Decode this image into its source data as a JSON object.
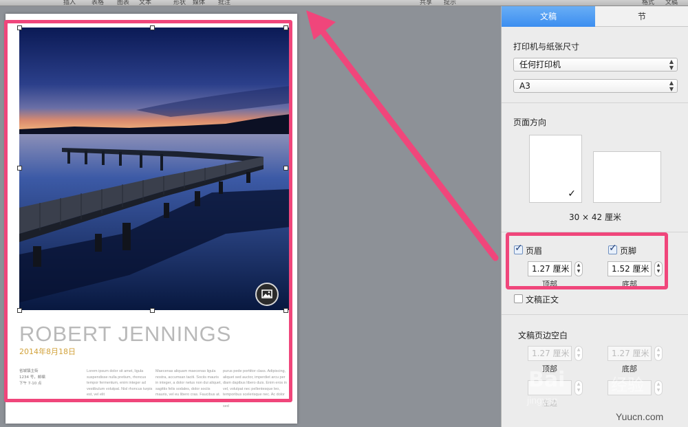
{
  "toolbar": {
    "items": [
      "插入",
      "表格",
      "图表",
      "文本",
      "形状",
      "媒体",
      "批注",
      "共享",
      "提示",
      "格式",
      "文稿"
    ]
  },
  "document": {
    "title": "ROBERT JENNINGS",
    "date": "2014年8月18日",
    "address": [
      "省城镇主街",
      "1234 号，邮编",
      "下午 7-10 点"
    ],
    "columns": [
      "Lorem ipsum dolor sit amet, ligula suspendisse nulla pretium, rhoncus tempor fermentum, enim integer ad vestibulum volutpat. Nisl rhoncus turpis est, vel elit",
      "Maecenas aliquam maecenas ligula nostra, accumsan taciti. Sociis mauris in integer, a dolor netus non dui aliquet, sagittis felis sodales, dolor sociis mauris, vel eu libero cras. Faucibus at. Arcu habitasse elementum est, ipsum",
      "purus pede porttitor class. Adipiscing, aliquet sed auctor, imperdiet arcu per diam dapibus libero duis. Enim eros in vel, volutpat nec pellentesque leo, temporibus scelerisque nec. Ac dolor ac adipiscing amet, tellus sed turpis sed"
    ]
  },
  "inspector": {
    "tabs": {
      "document": "文稿",
      "section": "节"
    },
    "printer_section": "打印机与纸张尺寸",
    "printer": "任何打印机",
    "paper": "A3",
    "orientation_section": "页面方向",
    "dimensions": "30 × 42 厘米",
    "header_label": "页眉",
    "header_value": "1.27 厘米",
    "header_sub": "顶部",
    "footer_label": "页脚",
    "footer_value": "1.52 厘米",
    "footer_sub": "底部",
    "body_label": "文稿正文",
    "margins_section": "文稿页边空白",
    "margin_top_value": "1.27 厘米",
    "margin_top_sub": "顶部",
    "margin_bottom_value": "1.27 厘米",
    "margin_bottom_sub": "底部",
    "margin_left_sub": "左边"
  },
  "watermarks": {
    "baidu": "Bai",
    "jingyan": "jingyan",
    "cn": "经验",
    "site": "Yuucn.com"
  },
  "colors": {
    "highlight": "#f0467b",
    "tab_active": "#3c8ef0",
    "date": "#d2a23a"
  }
}
